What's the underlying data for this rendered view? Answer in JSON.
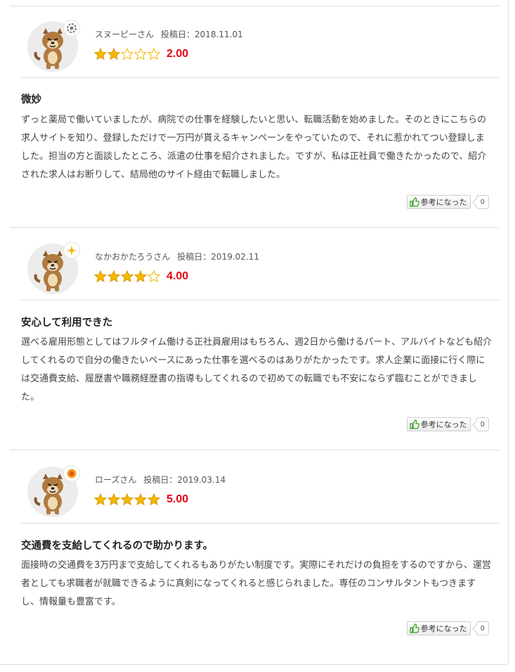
{
  "labels": {
    "posted_prefix": "投稿日：",
    "like_label": "参考になった"
  },
  "colors": {
    "score": "#e60012",
    "star_filled": "#f5b800",
    "star_empty": "#f5b800"
  },
  "reviews": [
    {
      "user": "スヌーピーさん",
      "date": "2018.11.01",
      "rating": 2,
      "score": "2.00",
      "badge_icon": "gear-icon",
      "title": "微妙",
      "body": "ずっと薬局で働いていましたが、病院での仕事を経験したいと思い、転職活動を始めました。そのときにこちらの求人サイトを知り、登録しただけで一万円が貰えるキャンペーンをやっていたので、それに惹かれてつい登録しました。担当の方と面談したところ、派遣の仕事を紹介されました。ですが、私は正社員で働きたかったので、紹介された求人はお断りして、結局他のサイト経由で転職しました。",
      "like_count": "0"
    },
    {
      "user": "なかおかたろうさん",
      "date": "2019.02.11",
      "rating": 4,
      "score": "4.00",
      "badge_icon": "sparkle-icon",
      "title": "安心して利用できた",
      "body": "選べる雇用形態としてはフルタイム働ける正社員雇用はもちろん、週2日から働けるパート、アルバイトなども紹介してくれるので自分の働きたいペースにあった仕事を選べるのはありがたかったです。求人企業に面接に行く際には交通費支給、履歴書や職務経歴書の指導もしてくれるので初めての転職でも不安にならず臨むことができました。",
      "like_count": "0"
    },
    {
      "user": "ローズさん",
      "date": "2019.03.14",
      "rating": 5,
      "score": "5.00",
      "badge_icon": "medal-icon",
      "title": "交通費を支給してくれるので助かります。",
      "body": "面接時の交通費を3万円まで支給してくれるもありがたい制度です。実際にそれだけの負担をするのですから、運営者としても求職者が就職できるように真剣になってくれると感じられました。専任のコンサルタントもつきますし、情報量も豊富です。",
      "like_count": "0"
    }
  ]
}
